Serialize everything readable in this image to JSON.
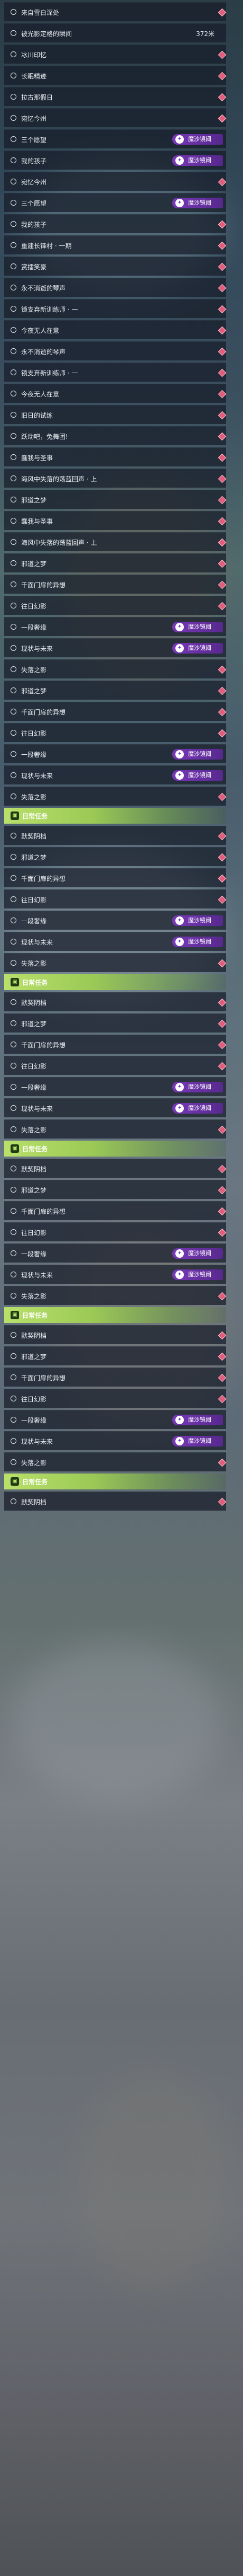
{
  "tag_label": "魔沙镜阈",
  "daily_label": "日常任务",
  "rows": [
    {
      "name": "来自雪白深处",
      "marker": true
    },
    {
      "name": "被光影定格的瞬间",
      "dist": "372米"
    },
    {
      "name": "冰川印忆",
      "marker": true
    },
    {
      "name": "长眠精迹",
      "marker": true
    },
    {
      "name": "拉古那假日",
      "marker": true
    },
    {
      "name": "宛忆今州",
      "marker": true
    },
    {
      "name": "三个愿望",
      "tag": true
    },
    {
      "name": "我的孩子",
      "tag": true
    },
    {
      "name": "宛忆今州",
      "marker": true
    },
    {
      "name": "三个愿望",
      "tag": true
    },
    {
      "name": "我的孩子",
      "marker": true
    },
    {
      "name": "重建长锋村 · 一期",
      "marker": true
    },
    {
      "name": "赏擂笑豪",
      "marker": true
    },
    {
      "name": "永不消逝的琴声",
      "marker": true
    },
    {
      "name": "锁支弃新训练师 · 一",
      "marker": true
    },
    {
      "name": "今夜无人在意",
      "marker": true
    },
    {
      "name": "永不消逝的琴声",
      "marker": true
    },
    {
      "name": "锁支弃新训练师 · 一",
      "marker": true
    },
    {
      "name": "今夜无人在意",
      "marker": true
    },
    {
      "name": "旧日的试炼",
      "marker": true
    },
    {
      "name": "跃动吧，兔舞团!",
      "marker": true
    },
    {
      "name": "蠢我与圣事",
      "marker": true
    },
    {
      "name": "海风中失落的荡蓝回声 · 上",
      "marker": true
    },
    {
      "name": "邪道之梦",
      "marker": true
    },
    {
      "name": "蠢我与圣事",
      "marker": true
    },
    {
      "name": "海风中失落的荡蓝回声 · 上",
      "marker": true
    },
    {
      "name": "邪道之梦",
      "marker": true
    },
    {
      "name": "千面门扉的异想",
      "marker": true
    },
    {
      "name": "往日幻影",
      "marker": true
    },
    {
      "name": "一段奢缘",
      "tag": true
    },
    {
      "name": "现状与未来",
      "tag": true
    },
    {
      "name": "失落之影",
      "marker": true
    },
    {
      "name": "邪道之梦",
      "marker": true
    },
    {
      "name": "千面门扉的异想",
      "marker": true
    },
    {
      "name": "往日幻影",
      "marker": true
    },
    {
      "name": "一段奢缘",
      "tag": true
    },
    {
      "name": "现状与未来",
      "tag": true
    },
    {
      "name": "失落之影",
      "marker": true
    },
    {
      "header": true
    },
    {
      "name": "默契阴档",
      "marker": true
    },
    {
      "name": "邪道之梦",
      "marker": true
    },
    {
      "name": "千面门扉的异想",
      "marker": true
    },
    {
      "name": "往日幻影",
      "marker": true
    },
    {
      "name": "一段奢缘",
      "tag": true
    },
    {
      "name": "现状与未来",
      "tag": true
    },
    {
      "name": "失落之影",
      "marker": true
    },
    {
      "header": true
    },
    {
      "name": "默契阴档",
      "marker": true
    },
    {
      "name": "邪道之梦",
      "marker": true
    },
    {
      "name": "千面门扉的异想",
      "marker": true
    },
    {
      "name": "往日幻影",
      "marker": true
    },
    {
      "name": "一段奢缘",
      "tag": true
    },
    {
      "name": "现状与未来",
      "tag": true
    },
    {
      "name": "失落之影",
      "marker": true
    },
    {
      "header": true
    },
    {
      "name": "默契阴档",
      "marker": true
    },
    {
      "name": "邪道之梦",
      "marker": true
    },
    {
      "name": "千面门扉的异想",
      "marker": true
    },
    {
      "name": "往日幻影",
      "marker": true
    },
    {
      "name": "一段奢缘",
      "tag": true
    },
    {
      "name": "现状与未来",
      "tag": true
    },
    {
      "name": "失落之影",
      "marker": true
    },
    {
      "header": true
    },
    {
      "name": "默契阴档",
      "marker": true
    },
    {
      "name": "邪道之梦",
      "marker": true
    },
    {
      "name": "千面门扉的异想",
      "marker": true
    },
    {
      "name": "往日幻影",
      "marker": true
    },
    {
      "name": "一段奢缘",
      "tag": true
    },
    {
      "name": "现状与未来",
      "tag": true
    },
    {
      "name": "失落之影",
      "marker": true
    },
    {
      "header": true
    },
    {
      "name": "默契阴档",
      "marker": true
    }
  ]
}
